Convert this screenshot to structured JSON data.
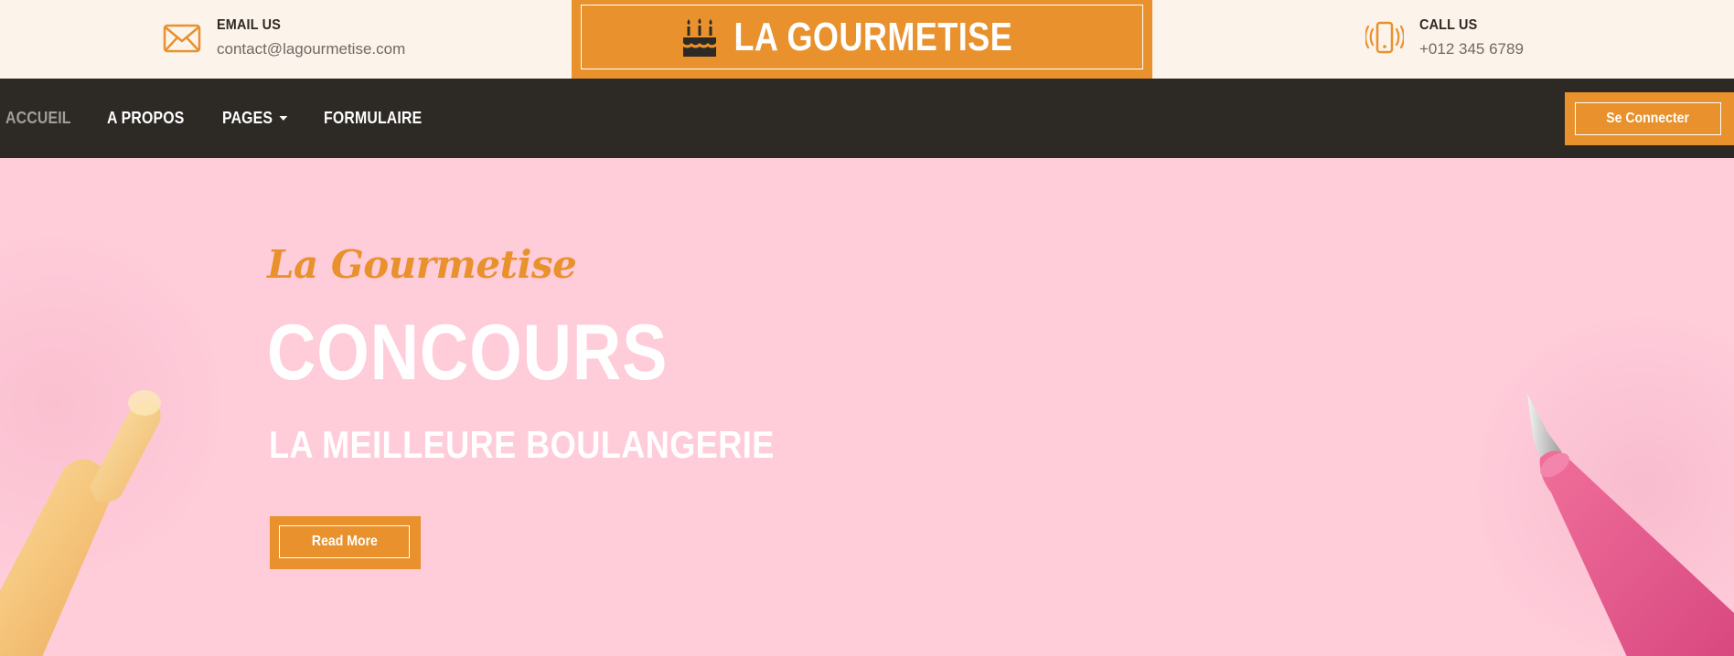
{
  "topbar": {
    "email": {
      "label": "EMAIL US",
      "value": "contact@lagourmetise.com",
      "icon": "envelope-icon"
    },
    "phone": {
      "label": "CALL US",
      "value": "+012 345 6789",
      "icon": "phone-vibrate-icon"
    }
  },
  "brand": {
    "title": "LA GOURMETISE",
    "icon": "birthday-cake-icon"
  },
  "nav": {
    "items": [
      {
        "label": "ACCUEIL",
        "active": true
      },
      {
        "label": "A PROPOS"
      },
      {
        "label": "PAGES",
        "dropdown": true
      },
      {
        "label": "FORMULAIRE"
      }
    ],
    "login_label": "Se Connecter"
  },
  "hero": {
    "subtitle": "La Gourmetise",
    "headline": "CONCOURS",
    "tagline": "LA MEILLEURE BOULANGERIE",
    "cta_label": "Read More"
  },
  "colors": {
    "accent": "#E8912D",
    "nav_bg": "#2D2925",
    "hero_bg": "#FFCCDA",
    "topbar_bg": "#FCF3EA"
  }
}
